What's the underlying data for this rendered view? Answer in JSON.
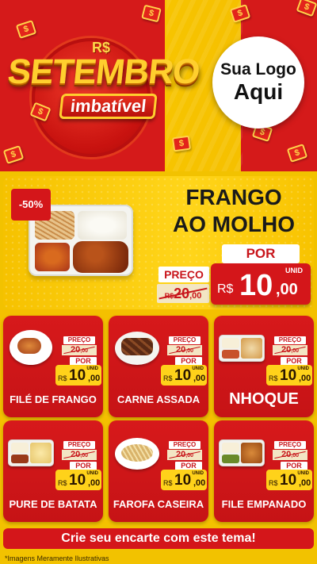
{
  "header": {
    "currency_symbol": "R$",
    "title": "SETEMBRO",
    "subtitle": "imbatível",
    "logo_line1": "Sua Logo",
    "logo_line2": "Aqui",
    "colors": {
      "red": "#d51a1a",
      "yellow": "#f7c400",
      "gold": "#ffcf2e"
    }
  },
  "featured": {
    "discount": "-50%",
    "title_line1": "FRANGO",
    "title_line2": "AO MOLHO",
    "preco_label": "PREÇO",
    "old_price_currency": "R$",
    "old_price_int": "20",
    "old_price_cents": ",00",
    "por_label": "POR",
    "unit_label": "UNID",
    "new_price_currency": "R$",
    "new_price_int": "10",
    "new_price_cents": ",00"
  },
  "products": [
    {
      "name": "FILÉ DE FRANGO",
      "image": "plate-chicken",
      "preco_label": "PREÇO",
      "old_price": "20",
      "old_cents": ",00",
      "por_label": "POR",
      "unit_label": "UNID",
      "currency": "R$",
      "price_int": "10",
      "price_cents": ",00"
    },
    {
      "name": "CARNE ASSADA",
      "image": "bowl-beef",
      "preco_label": "PREÇO",
      "old_price": "20",
      "old_cents": ",00",
      "por_label": "POR",
      "unit_label": "UNID",
      "currency": "R$",
      "price_int": "10",
      "price_cents": ",00"
    },
    {
      "name": "NHOQUE",
      "image": "tray-gnocchi",
      "preco_label": "PREÇO",
      "old_price": "20",
      "old_cents": ",00",
      "por_label": "POR",
      "unit_label": "UNID",
      "currency": "R$",
      "price_int": "10",
      "price_cents": ",00"
    },
    {
      "name": "PURE DE BATATA",
      "image": "tray-mash",
      "preco_label": "PREÇO",
      "old_price": "20",
      "old_cents": ",00",
      "por_label": "POR",
      "unit_label": "UNID",
      "currency": "R$",
      "price_int": "10",
      "price_cents": ",00"
    },
    {
      "name": "FAROFA CASEIRA",
      "image": "bowl-farofa",
      "preco_label": "PREÇO",
      "old_price": "20",
      "old_cents": ",00",
      "por_label": "POR",
      "unit_label": "UNID",
      "currency": "R$",
      "price_int": "10",
      "price_cents": ",00"
    },
    {
      "name": "FILE EMPANADO",
      "image": "tray-breaded",
      "preco_label": "PREÇO",
      "old_price": "20",
      "old_cents": ",00",
      "por_label": "POR",
      "unit_label": "UNID",
      "currency": "R$",
      "price_int": "10",
      "price_cents": ",00"
    }
  ],
  "cta": "Crie seu encarte com este tema!",
  "disclaimer": "*Imagens Meramente Ilustrativas"
}
